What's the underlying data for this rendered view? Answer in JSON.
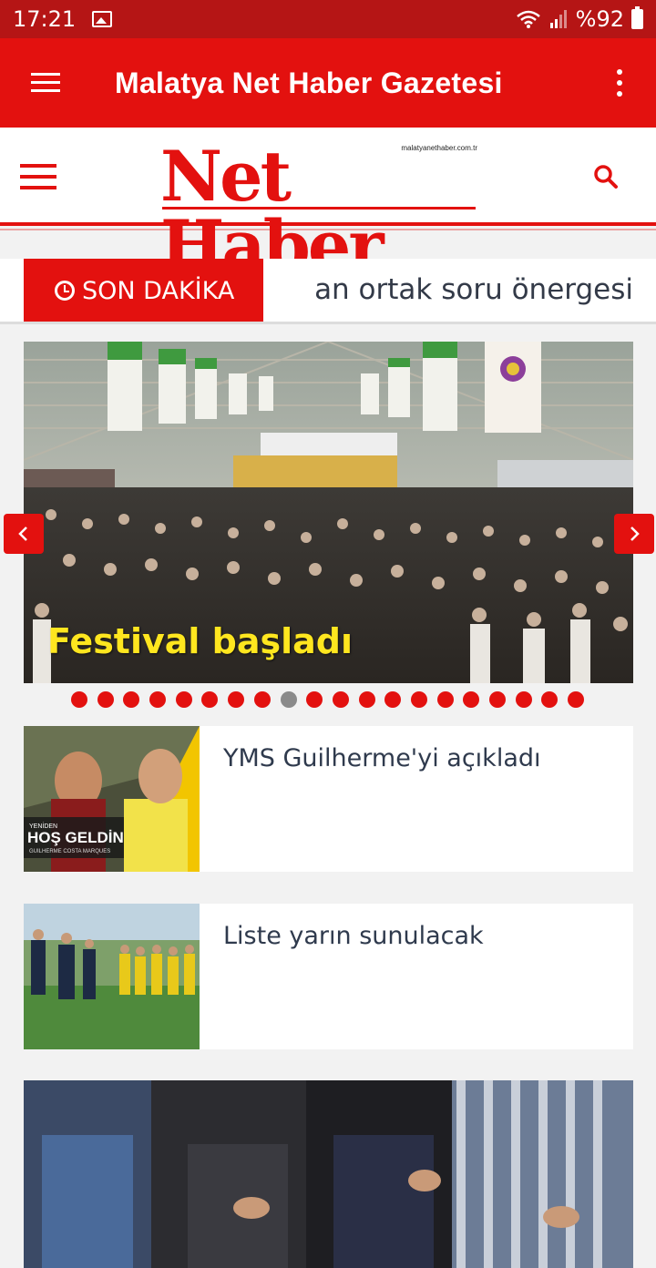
{
  "status_bar": {
    "time": "17:21",
    "battery": "%92"
  },
  "app_bar": {
    "title": "Malatya Net Haber Gazetesi"
  },
  "site_header": {
    "logo_text": "Net Haber",
    "logo_domain": "malatyanethaber.com.tr"
  },
  "breaking": {
    "label": "SON DAKİKA",
    "ticker": "an ortak soru önergesi"
  },
  "slider": {
    "caption": "Festival başladı",
    "dot_count": 20,
    "active_dot_index": 8
  },
  "articles": [
    {
      "headline": "YMS Guilherme'yi açıkladı"
    },
    {
      "headline": "Liste yarın sunulacak"
    }
  ],
  "thumbnail_texts": {
    "card1_overlay": "HOŞ GELDİN",
    "card1_small": "YENİDEN",
    "card1_name": "GUILHERME COSTA MARQUES"
  },
  "colors": {
    "primary_red": "#e3110f",
    "status_red": "#b51515",
    "caption_yellow": "#ffe61f"
  }
}
